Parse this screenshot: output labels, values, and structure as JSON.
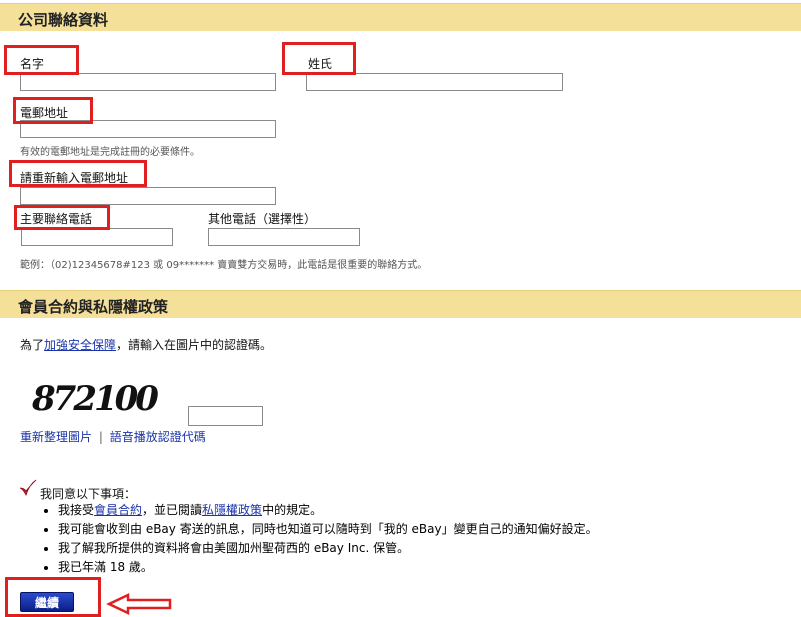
{
  "contact_section": {
    "title": "公司聯絡資料",
    "first_name_label": "名字",
    "last_name_label": "姓氏",
    "email_label": "電郵地址",
    "email_hint": "有效的電郵地址是完成註冊的必要條件。",
    "email_confirm_label": "請重新輸入電郵地址",
    "primary_phone_label": "主要聯絡電話",
    "other_phone_label": "其他電話（選擇性）",
    "phone_hint": "範例：（02)12345678#123 或 09******* 賣賣雙方交易時，此電話是很重要的聯絡方式。",
    "first_name_value": "",
    "last_name_value": "",
    "email_value": "",
    "email_confirm_value": "",
    "primary_phone_value": "",
    "other_phone_value": ""
  },
  "policy_section": {
    "title": "會員合約與私隱權政策",
    "captcha_prefix": "為了",
    "captcha_link": "加強安全保障",
    "captcha_suffix": "，請輸入在圖片中的認證碼。",
    "captcha_image_text": "872100",
    "captcha_value": "",
    "refresh_link": "重新整理圖片",
    "separator": "|",
    "audio_link": "語音播放認證代碼",
    "agree_heading": "我同意以下事項：",
    "terms": {
      "prefix": "我接受",
      "user_agreement_link": "會員合約",
      "middle": "，並已閱讀",
      "privacy_link": "私隱權政策",
      "suffix": "中的規定。"
    },
    "bullet_2": "我可能會收到由 eBay 寄送的訊息，同時也知道可以隨時到「我的 eBay」變更自己的通知偏好設定。",
    "bullet_3": "我了解我所提供的資料將會由美國加州聖荷西的 eBay Inc. 保管。",
    "bullet_4": "我已年滿 18 歲。",
    "continue_button": "繼續"
  },
  "colors": {
    "section_bar": "#f5e09a",
    "highlight_box": "#e02020",
    "link": "#1a33a8",
    "button": "#0a1f85"
  }
}
